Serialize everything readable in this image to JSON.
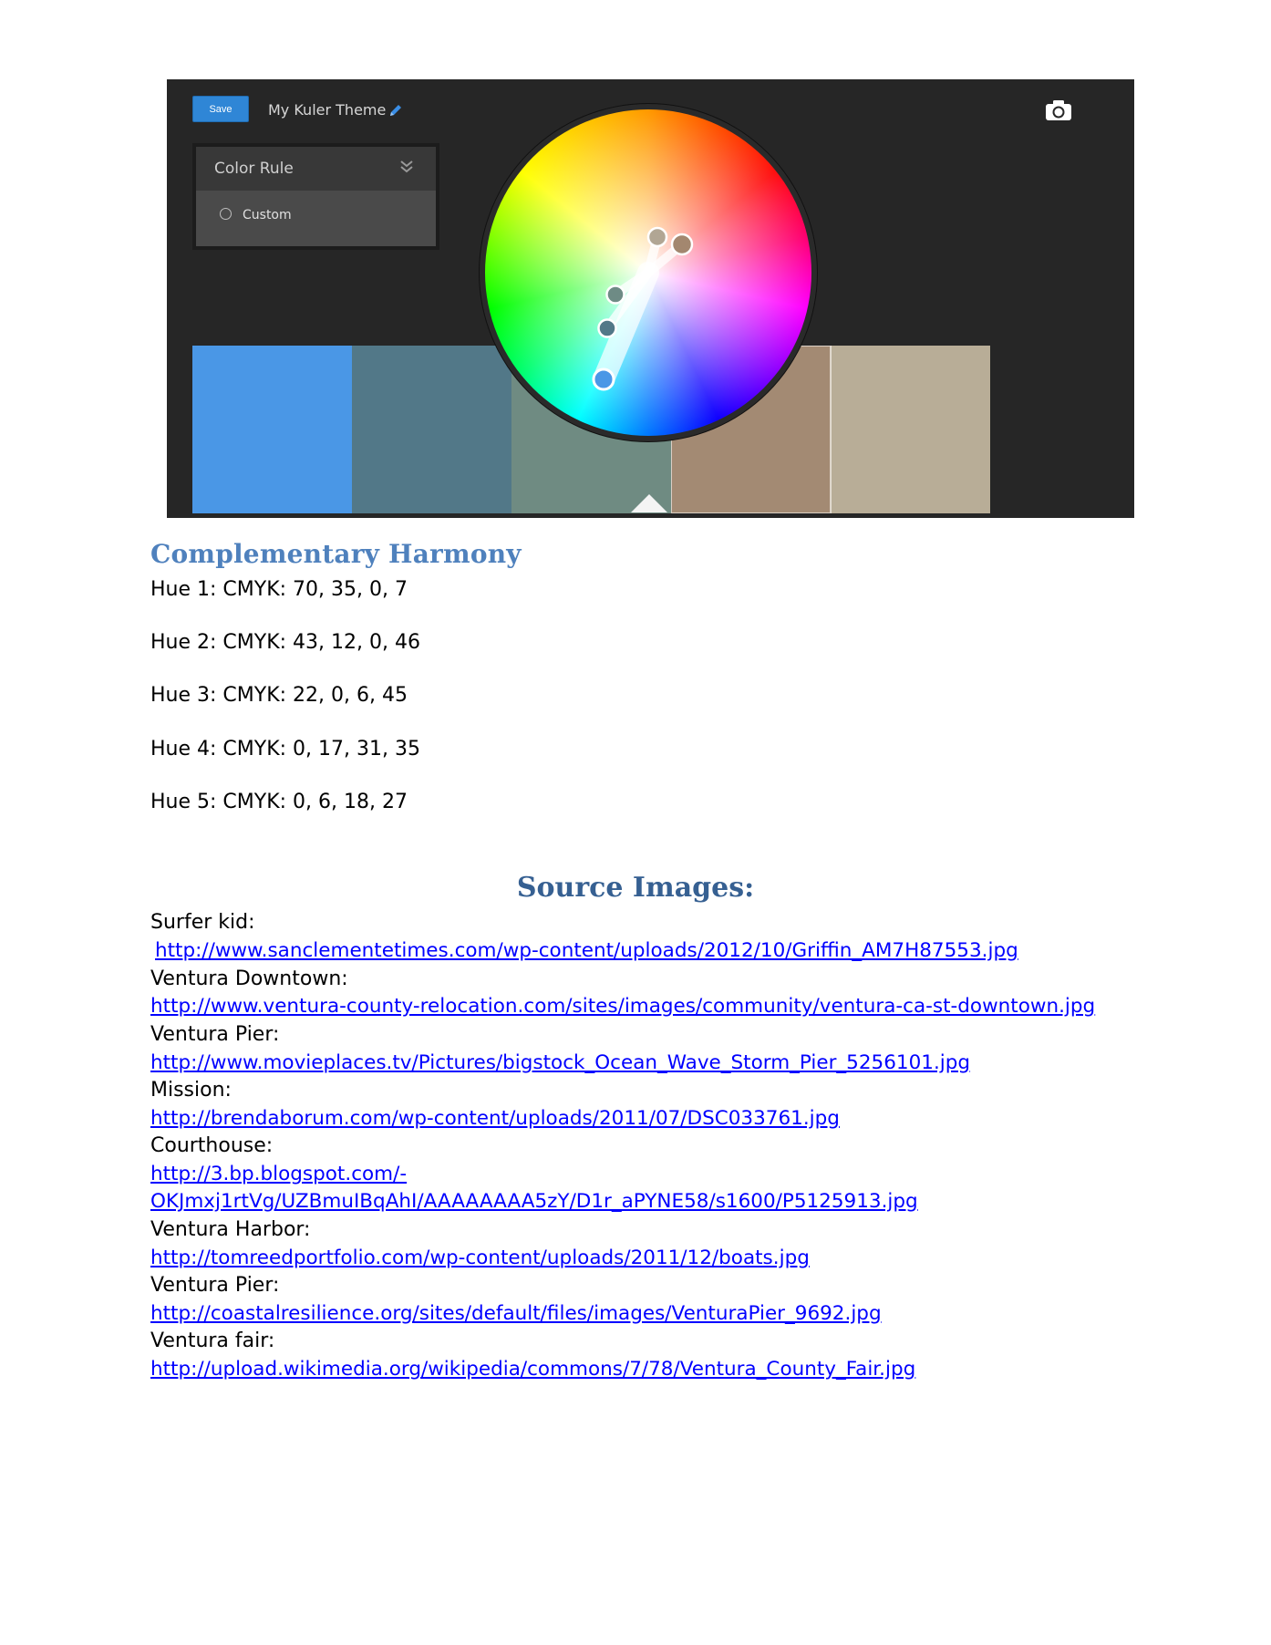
{
  "kuler": {
    "save_label": "Save",
    "theme_title": "My Kuler Theme",
    "color_rule_label": "Color Rule",
    "rule_option": "Custom",
    "swatches": [
      "#4a97e6",
      "#527888",
      "#6f8b82",
      "#a38a73",
      "#b8ad97"
    ],
    "wheel_handles": [
      "#a3876f",
      "#b1a694",
      "#6e8b85",
      "#527888",
      "#4a97e6"
    ]
  },
  "doc": {
    "heading": "Complementary Harmony",
    "hues": [
      "Hue 1:  CMYK:  70, 35, 0, 7",
      "Hue 2:  CMYK:  43, 12, 0, 46",
      "Hue 3:  CMYK:  22, 0, 6, 45",
      "Hue 4:  CMYK:  0, 17, 31, 35",
      "Hue 5:  CMYK: 0, 6, 18, 27"
    ],
    "sources_heading": "Source Images:",
    "sources": [
      {
        "label": "Surfer kid:",
        "url": "http://www.sanclementetimes.com/wp-content/uploads/2012/10/Griffin_AM7H87553.jpg"
      },
      {
        "label": "Ventura Downtown:",
        "url": "http://www.ventura-county-relocation.com/sites/images/community/ventura-ca-st-downtown.jpg"
      },
      {
        "label": "Ventura Pier:",
        "url": "http://www.movieplaces.tv/Pictures/bigstock_Ocean_Wave_Storm_Pier_5256101.jpg"
      },
      {
        "label": "Mission:",
        "url": "http://brendaborum.com/wp-content/uploads/2011/07/DSC033761.jpg"
      },
      {
        "label": "Courthouse:",
        "url_line1": "http://3.bp.blogspot.com/-",
        "url_line2": "OKJmxj1rtVg/UZBmuIBqAhI/AAAAAAAA5zY/D1r_aPYNE58/s1600/P5125913.jpg"
      },
      {
        "label": "Ventura Harbor:",
        "url": "http://tomreedportfolio.com/wp-content/uploads/2011/12/boats.jpg"
      },
      {
        "label": "Ventura Pier:",
        "url": "http://coastalresilience.org/sites/default/files/images/VenturaPier_9692.jpg"
      },
      {
        "label": "Ventura fair:",
        "url": "http://upload.wikimedia.org/wikipedia/commons/7/78/Ventura_County_Fair.jpg"
      }
    ]
  }
}
